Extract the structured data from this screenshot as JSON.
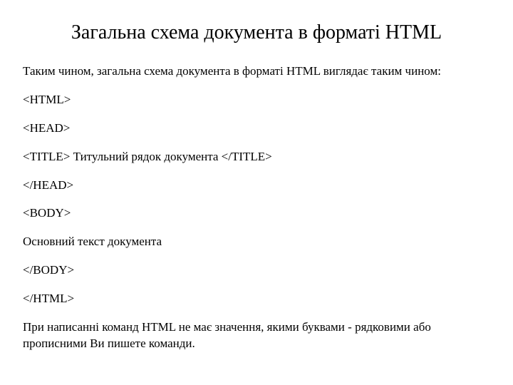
{
  "title": "Загальна схема документа в форматі HTML",
  "intro": "Таким чином, загальна схема документа в форматі HTML виглядає таким чином:",
  "lines": {
    "l1": "<HTML>",
    "l2": "<HEAD>",
    "l3": "<TITLE> Титульний рядок документа </TITLE>",
    "l4": "</HEAD>",
    "l5": "<BODY>",
    "l6": "Основний текст документа",
    "l7": "</BODY>",
    "l8": "</HTML>"
  },
  "outro": "При написанні команд HTML не має значення, якими буквами - рядковими або прописними Ви пишете команди."
}
